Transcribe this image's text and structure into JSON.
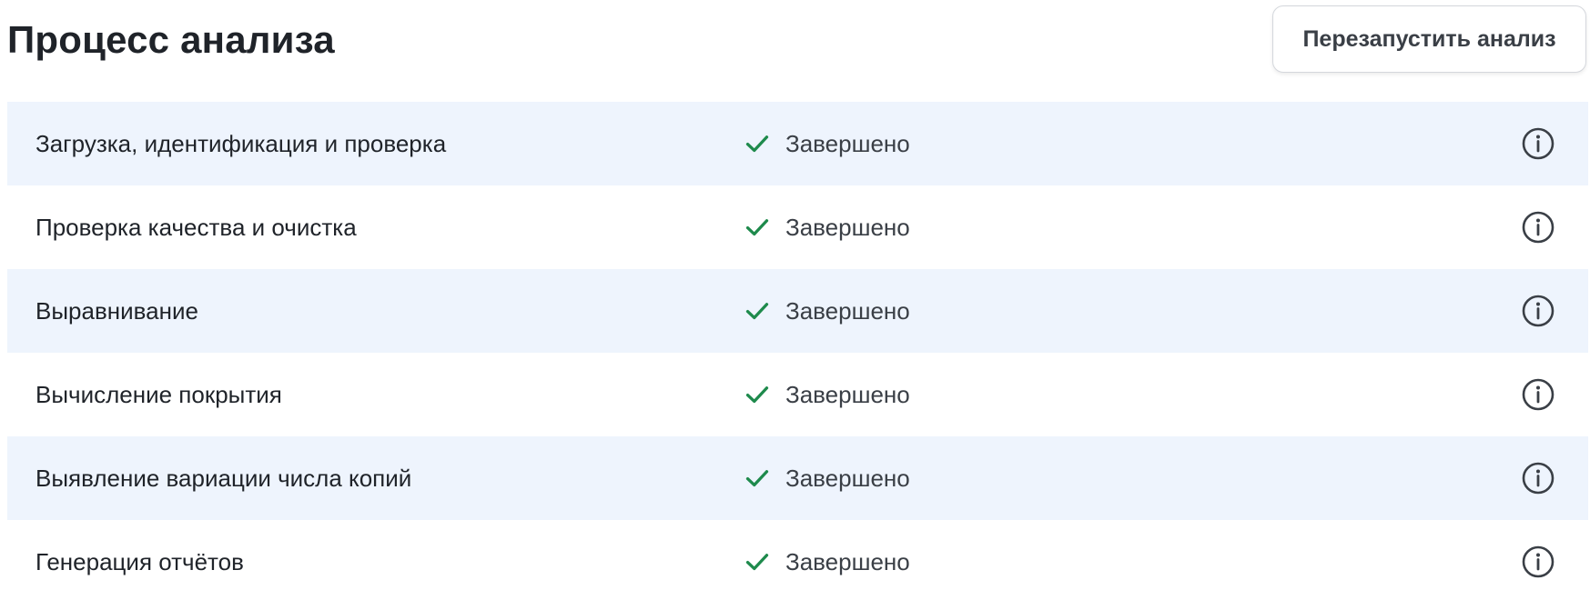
{
  "header": {
    "title": "Процесс анализа",
    "restart_label": "Перезапустить анализ"
  },
  "steps": [
    {
      "name": "Загрузка, идентификация и проверка",
      "status": "Завершено"
    },
    {
      "name": "Проверка качества и очистка",
      "status": "Завершено"
    },
    {
      "name": "Выравнивание",
      "status": "Завершено"
    },
    {
      "name": "Вычисление покрытия",
      "status": "Завершено"
    },
    {
      "name": "Выявление вариации числа копий",
      "status": "Завершено"
    },
    {
      "name": "Генерация отчётов",
      "status": "Завершено"
    }
  ],
  "icons": {
    "status": "check-icon",
    "details": "info-icon"
  },
  "colors": {
    "row_alt_bg": "#eef4fd",
    "check": "#1e8a4c",
    "text": "#1f2329",
    "info_icon": "#3a3f46"
  }
}
